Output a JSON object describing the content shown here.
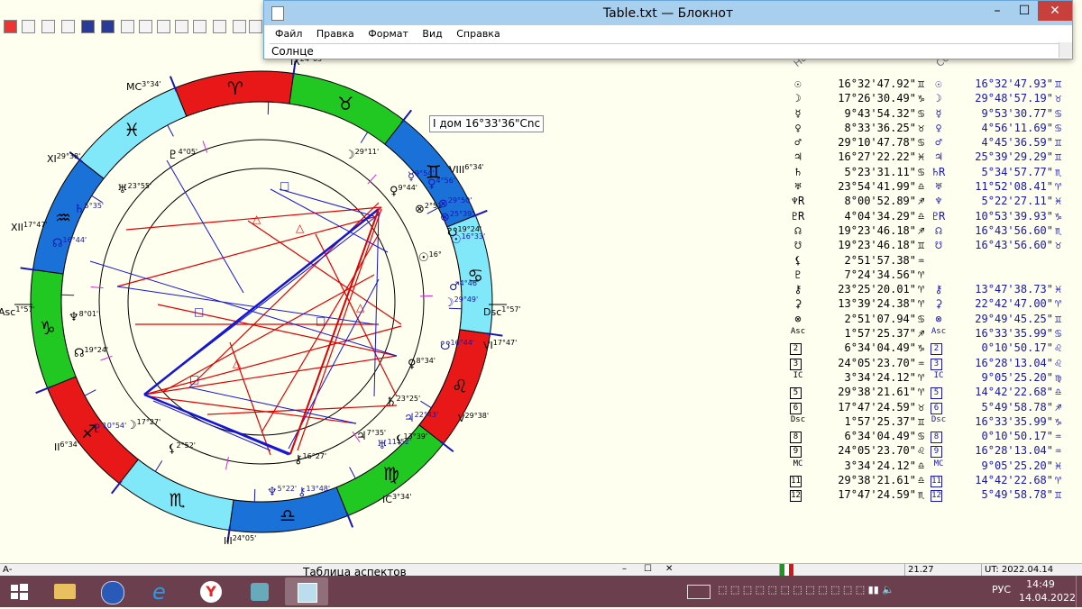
{
  "notepad": {
    "title": "Table.txt — Блокнот",
    "menu": [
      "Файл",
      "Правка",
      "Формат",
      "Вид",
      "Справка"
    ],
    "edit_text": "Солнце"
  },
  "tooltip": "I дом 16°33'36\"Cnc",
  "table_headers": [
    "Нат",
    "Сол"
  ],
  "zodiac": [
    {
      "glyph": "♋",
      "color": "#80e8f8"
    },
    {
      "glyph": "♊",
      "color": "#1a72d8"
    },
    {
      "glyph": "♉",
      "color": "#22c822"
    },
    {
      "glyph": "♈",
      "color": "#e81818"
    },
    {
      "glyph": "♓",
      "color": "#80e8f8"
    },
    {
      "glyph": "♒",
      "color": "#1a72d8"
    },
    {
      "glyph": "♑",
      "color": "#22c822"
    },
    {
      "glyph": "♐",
      "color": "#e81818"
    },
    {
      "glyph": "♏",
      "color": "#80e8f8"
    },
    {
      "glyph": "♎",
      "color": "#1a72d8"
    },
    {
      "glyph": "♍",
      "color": "#22c822"
    },
    {
      "glyph": "♌",
      "color": "#e81818"
    }
  ],
  "chart_labels": [
    {
      "name": "house-label-ix",
      "text": "IX",
      "sup": "24°05'"
    },
    {
      "name": "house-label-mc",
      "text": "MC",
      "sup": "3°34'"
    },
    {
      "name": "house-label-xi",
      "text": "XI",
      "sup": "29°38'"
    },
    {
      "name": "house-label-xii",
      "text": "XII",
      "sup": "17°47'"
    },
    {
      "name": "house-label-asc",
      "text": "Asc",
      "sup": "1°57'"
    },
    {
      "name": "house-label-ii",
      "text": "II",
      "sup": "6°34'"
    },
    {
      "name": "house-label-iii",
      "text": "III",
      "sup": "24°05'"
    },
    {
      "name": "house-label-ic",
      "text": "IC",
      "sup": "3°34'"
    },
    {
      "name": "house-label-v",
      "text": "V",
      "sup": "29°38'"
    },
    {
      "name": "house-label-vi",
      "text": "VI",
      "sup": "17°47'"
    },
    {
      "name": "house-label-dsc",
      "text": "Dsc",
      "sup": "1°57'"
    },
    {
      "name": "house-label-viii",
      "text": "VIII",
      "sup": "6°34'"
    }
  ],
  "planet_labels": [
    {
      "name": "pluto-natal",
      "glyph": "♇",
      "deg": "4°05'",
      "color": "#000"
    },
    {
      "name": "moon-natal",
      "glyph": "☽",
      "deg": "29°11'",
      "color": "#000"
    },
    {
      "name": "neptune-natal-top",
      "glyph": "♅",
      "deg": "23°55'",
      "color": "#000"
    },
    {
      "name": "saturn-transit",
      "glyph": "♄",
      "deg": "5°35'",
      "color": "#1515b8"
    },
    {
      "name": "node-transit",
      "glyph": "☊",
      "deg": "16°44'",
      "color": "#1515b8"
    },
    {
      "name": "neptune-natal",
      "glyph": "♆",
      "deg": "8°01'",
      "color": "#000"
    },
    {
      "name": "node-natal",
      "glyph": "☊",
      "deg": "19°24'",
      "color": "#000"
    },
    {
      "name": "pluto-transit",
      "glyph": "♇",
      "deg": "10°54'",
      "color": "#1515b8"
    },
    {
      "name": "moon-transit",
      "glyph": "☽",
      "deg": "17°27'",
      "color": "#000"
    },
    {
      "name": "lilith-natal",
      "glyph": "⚸",
      "deg": "2°52'",
      "color": "#000"
    },
    {
      "name": "chiron-natal",
      "glyph": "⚷",
      "deg": "16°27'",
      "color": "#000"
    },
    {
      "name": "neptune-transit",
      "glyph": "♆",
      "deg": "5°22'",
      "color": "#1515b8"
    },
    {
      "name": "chiron-transit",
      "glyph": "⚷",
      "deg": "13°48'",
      "color": "#1515b8"
    },
    {
      "name": "jupiter-natal",
      "glyph": "♃",
      "deg": "7°35'",
      "color": "#000"
    },
    {
      "name": "uranus-transit",
      "glyph": "♅",
      "deg": "11°52'",
      "color": "#1515b8"
    },
    {
      "name": "lilith-transit",
      "glyph": "⚸",
      "deg": "13°39'",
      "color": "#000"
    },
    {
      "name": "proserpina-transit",
      "glyph": "♃",
      "deg": "22°43'",
      "color": "#1515b8"
    },
    {
      "name": "saturn-natal",
      "glyph": "♄",
      "deg": "23°25'",
      "color": "#000"
    },
    {
      "name": "venus-natal",
      "glyph": "♀",
      "deg": "8°34'",
      "color": "#000"
    },
    {
      "name": "node-transit-2",
      "glyph": "☋",
      "deg": "16°44'",
      "color": "#1515b8"
    },
    {
      "name": "moon-transit-2",
      "glyph": "☽",
      "deg": "29°49'",
      "color": "#1515b8"
    },
    {
      "name": "mars-transit",
      "glyph": "♂",
      "deg": "4°46'",
      "color": "#1515b8"
    },
    {
      "name": "sun-natal",
      "glyph": "☉",
      "deg": "16°",
      "color": "#000"
    },
    {
      "name": "sun-transit",
      "glyph": "☉",
      "deg": "16°33'",
      "color": "#1515b8"
    },
    {
      "name": "node-natal-2",
      "glyph": "☋",
      "deg": "19°24'",
      "color": "#000"
    },
    {
      "name": "fortune-transit",
      "glyph": "⊗",
      "deg": "25°39'",
      "color": "#1515b8"
    },
    {
      "name": "fortune-natal",
      "glyph": "⊗",
      "deg": "2°51'",
      "color": "#000"
    },
    {
      "name": "fortune-transit-2",
      "glyph": "⊗",
      "deg": "29°50'",
      "color": "#1515b8"
    },
    {
      "name": "mercury-natal",
      "glyph": "♀",
      "deg": "9°44'",
      "color": "#000"
    },
    {
      "name": "mercury-transit",
      "glyph": "☿",
      "deg": "9°54'",
      "color": "#1515b8"
    },
    {
      "name": "venus-transit",
      "glyph": "♀",
      "deg": "4°56'",
      "color": "#1515b8"
    }
  ],
  "table": [
    {
      "g1": "☉",
      "v1": "16°32'47.92\"",
      "s1": "♊",
      "g2": "☉",
      "v2": "16°32'47.93\"",
      "s2": "♊"
    },
    {
      "g1": "☽",
      "v1": "17°26'30.49\"",
      "s1": "♑",
      "g2": "☽",
      "v2": "29°48'57.19\"",
      "s2": "♉"
    },
    {
      "g1": "☿",
      "v1": "9°43'54.32\"",
      "s1": "♋",
      "g2": "☿",
      "v2": "9°53'30.77\"",
      "s2": "♋"
    },
    {
      "g1": "♀",
      "v1": "8°33'36.25\"",
      "s1": "♉",
      "g2": "♀",
      "v2": "4°56'11.69\"",
      "s2": "♋"
    },
    {
      "g1": "♂",
      "v1": "29°10'47.78\"",
      "s1": "♋",
      "g2": "♂",
      "v2": "4°45'36.59\"",
      "s2": "♊"
    },
    {
      "g1": "♃",
      "v1": "16°27'22.22\"",
      "s1": "♓",
      "g2": "♃",
      "v2": "25°39'29.29\"",
      "s2": "♊"
    },
    {
      "g1": "♄",
      "v1": "5°23'31.11\"",
      "s1": "♋",
      "g2": "♄R",
      "v2": "5°34'57.77\"",
      "s2": "♏"
    },
    {
      "g1": "♅",
      "v1": "23°54'41.99\"",
      "s1": "♎",
      "g2": "♅",
      "v2": "11°52'08.41\"",
      "s2": "♈"
    },
    {
      "g1": "♆R",
      "v1": "8°00'52.89\"",
      "s1": "♐",
      "g2": "♆",
      "v2": "5°22'27.11\"",
      "s2": "♓"
    },
    {
      "g1": "♇R",
      "v1": "4°04'34.29\"",
      "s1": "♎",
      "g2": "♇R",
      "v2": "10°53'39.93\"",
      "s2": "♑"
    },
    {
      "g1": "☊",
      "v1": "19°23'46.18\"",
      "s1": "♐",
      "g2": "☊",
      "v2": "16°43'56.60\"",
      "s2": "♏"
    },
    {
      "g1": "☋",
      "v1": "19°23'46.18\"",
      "s1": "♊",
      "g2": "☋",
      "v2": "16°43'56.60\"",
      "s2": "♉"
    },
    {
      "g1": "⚸",
      "v1": "2°51'57.38\"",
      "s1": "♒",
      "g2": "",
      "v2": "",
      "s2": ""
    },
    {
      "g1": "♇",
      "v1": "7°24'34.56\"",
      "s1": "♈",
      "g2": "",
      "v2": "",
      "s2": ""
    },
    {
      "g1": "⚷",
      "v1": "23°25'20.01\"",
      "s1": "♈",
      "g2": "⚷",
      "v2": "13°47'38.73\"",
      "s2": "♓"
    },
    {
      "g1": "⚳",
      "v1": "13°39'24.38\"",
      "s1": "♈",
      "g2": "⚳",
      "v2": "22°42'47.00\"",
      "s2": "♈"
    },
    {
      "g1": "⊗",
      "v1": "2°51'07.94\"",
      "s1": "♋",
      "g2": "⊗",
      "v2": "29°49'45.25\"",
      "s2": "♊"
    },
    {
      "g1": "Asc",
      "v1": "1°57'25.37\"",
      "s1": "♐",
      "g2": "Asc",
      "v2": "16°33'35.99\"",
      "s2": "♋"
    },
    {
      "g1": "2",
      "v1": "6°34'04.49\"",
      "s1": "♑",
      "g2": "2",
      "v2": "0°10'50.17\"",
      "s2": "♌"
    },
    {
      "g1": "3",
      "v1": "24°05'23.70\"",
      "s1": "♒",
      "g2": "3",
      "v2": "16°28'13.04\"",
      "s2": "♌"
    },
    {
      "g1": "IC",
      "v1": "3°34'24.12\"",
      "s1": "♈",
      "g2": "IC",
      "v2": "9°05'25.20\"",
      "s2": "♍"
    },
    {
      "g1": "5",
      "v1": "29°38'21.61\"",
      "s1": "♈",
      "g2": "5",
      "v2": "14°42'22.68\"",
      "s2": "♎"
    },
    {
      "g1": "6",
      "v1": "17°47'24.59\"",
      "s1": "♉",
      "g2": "6",
      "v2": "5°49'58.78\"",
      "s2": "♐"
    },
    {
      "g1": "Dsc",
      "v1": "1°57'25.37\"",
      "s1": "♊",
      "g2": "Dsc",
      "v2": "16°33'35.99\"",
      "s2": "♑"
    },
    {
      "g1": "8",
      "v1": "6°34'04.49\"",
      "s1": "♋",
      "g2": "8",
      "v2": "0°10'50.17\"",
      "s2": "♒"
    },
    {
      "g1": "9",
      "v1": "24°05'23.70\"",
      "s1": "♌",
      "g2": "9",
      "v2": "16°28'13.04\"",
      "s2": "♒"
    },
    {
      "g1": "MC",
      "v1": "3°34'24.12\"",
      "s1": "♎",
      "g2": "MC",
      "v2": "9°05'25.20\"",
      "s2": "♓"
    },
    {
      "g1": "11",
      "v1": "29°38'21.61\"",
      "s1": "♎",
      "g2": "11",
      "v2": "14°42'22.68\"",
      "s2": "♈"
    },
    {
      "g1": "12",
      "v1": "17°47'24.59\"",
      "s1": "♏",
      "g2": "12",
      "v2": "5°49'58.78\"",
      "s2": "♊"
    }
  ],
  "statusbar": {
    "left": "A‐",
    "center": "Таблица аспектов",
    "value": "21.27",
    "ut": "UT: 2022.04.14 11:49:58"
  },
  "taskbar": {
    "lang": "РУС",
    "time": "14:49",
    "date": "14.04.2022"
  },
  "colors": {
    "red": "#e81818",
    "green": "#22c822",
    "blue": "#1a72d8",
    "cyan": "#80e8f8",
    "aspect_red": "#e00000",
    "aspect_blue": "#1515d8"
  }
}
